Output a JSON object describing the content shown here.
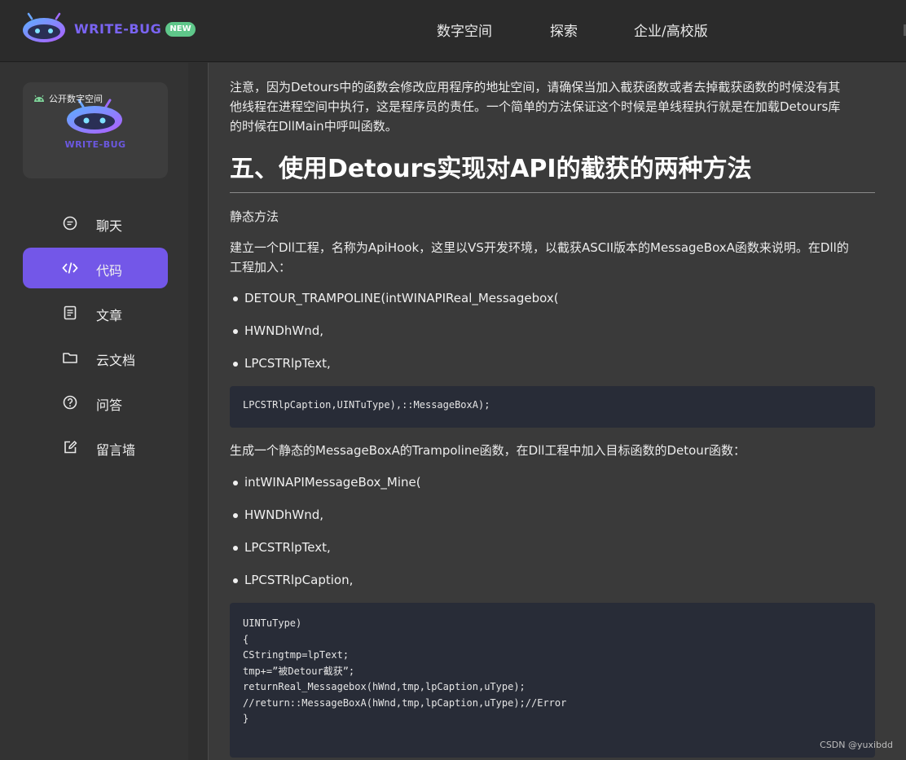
{
  "header": {
    "brand": "WRITE-BUG",
    "badge": "NEW",
    "nav": [
      "数字空间",
      "探索",
      "企业/高校版"
    ]
  },
  "sidebar": {
    "card": {
      "label": "公开数字空间",
      "brand": "WRITE-BUG"
    },
    "items": [
      {
        "label": "聊天",
        "icon": "chat-icon"
      },
      {
        "label": "代码",
        "icon": "code-icon",
        "active": true
      },
      {
        "label": "文章",
        "icon": "article-icon"
      },
      {
        "label": "云文档",
        "icon": "folder-icon"
      },
      {
        "label": "问答",
        "icon": "question-icon"
      },
      {
        "label": "留言墙",
        "icon": "edit-icon"
      }
    ]
  },
  "article": {
    "intro_lines": [
      "注意，因为Detours中的函数会修改应用程序的地址空间，请确保当加入截获函数或者去掉截获函数的时候没有其",
      "他线程在进程空间中执行，这是程序员的责任。一个简单的方法保证这个时候是单线程执行就是在加载Detours库",
      "的时候在DllMain中呼叫函数。"
    ],
    "heading": "五、使用Detours实现对API的截获的两种方法",
    "subheading": "静态方法",
    "para2_lines": [
      "建立一个Dll工程，名称为ApiHook，这里以VS开发环境，以截获ASCII版本的MessageBoxA函数来说明。在Dll的",
      "工程加入："
    ],
    "bullets1": [
      "DETOUR_TRAMPOLINE(intWINAPIReal_Messagebox(",
      "HWNDhWnd,",
      "LPCSTRlpText,"
    ],
    "code1": [
      "LPCSTRlpCaption,UINTuType),::MessageBoxA);"
    ],
    "para3": "生成一个静态的MessageBoxA的Trampoline函数，在Dll工程中加入目标函数的Detour函数：",
    "bullets2": [
      "intWINAPIMessageBox_Mine(",
      "HWNDhWnd,",
      "LPCSTRlpText,",
      "LPCSTRlpCaption,"
    ],
    "code2": [
      "UINTuType)",
      "{",
      "CStringtmp=lpText;",
      "tmp+=”被Detour截获”;",
      "returnReal_Messagebox(hWnd,tmp,lpCaption,uType);",
      "//return::MessageBoxA(hWnd,tmp,lpCaption,uType);//Error",
      "}"
    ]
  },
  "watermark": "CSDN @yuxibdd",
  "colors": {
    "accent": "#7357e8",
    "badge": "#5fc78a",
    "code_bg": "#282c37"
  }
}
